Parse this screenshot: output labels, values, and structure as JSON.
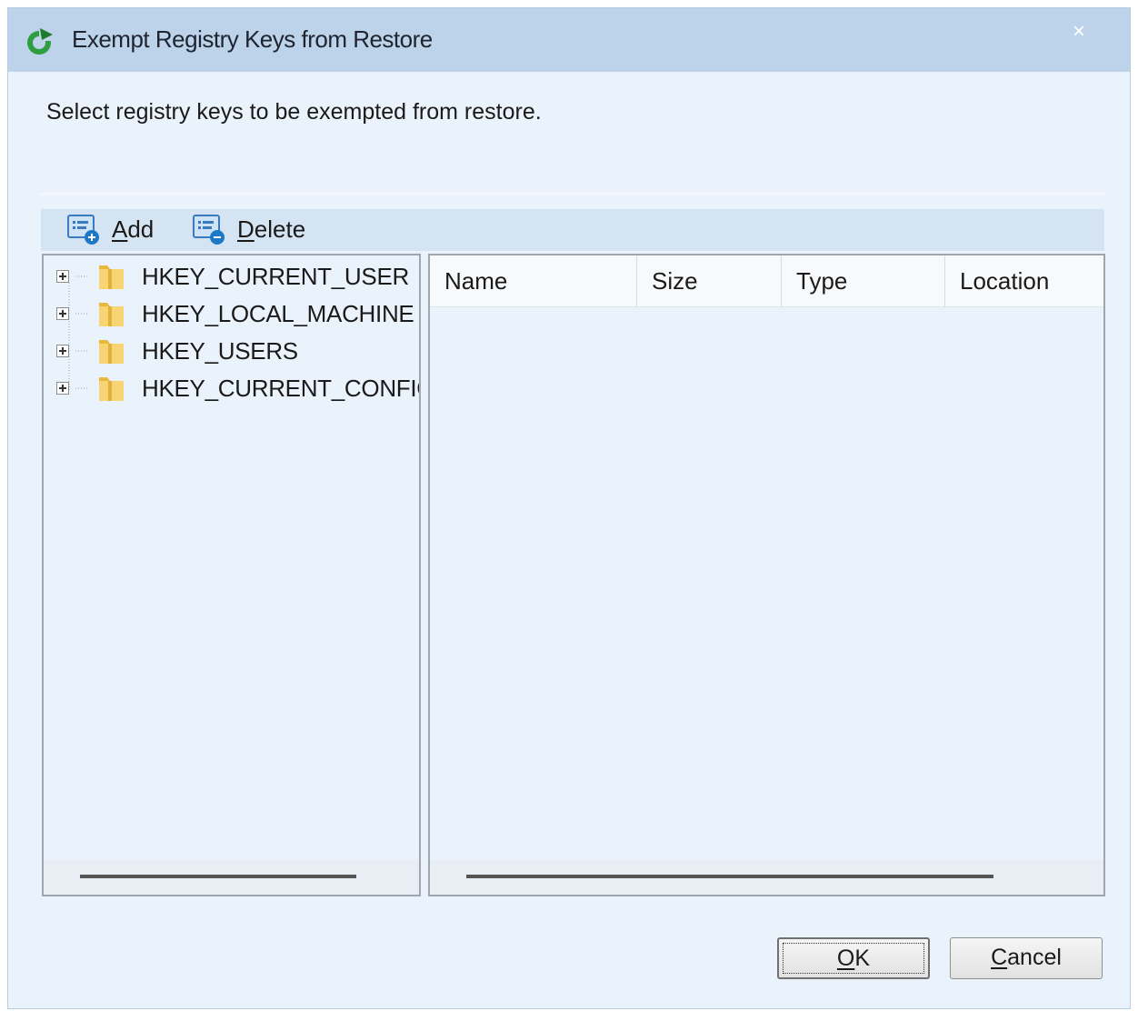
{
  "window": {
    "title": "Exempt Registry Keys from Restore",
    "close_glyph": "×"
  },
  "instruction": "Select registry keys to be exempted from restore.",
  "toolbar": {
    "add_accel": "A",
    "add_rest": "dd",
    "add_icon": "list-add-icon",
    "delete_accel": "D",
    "delete_rest": "elete",
    "delete_icon": "list-remove-icon"
  },
  "tree": {
    "items": [
      {
        "label": "HKEY_CURRENT_USER",
        "icon": "folder-icon",
        "expanded": false
      },
      {
        "label": "HKEY_LOCAL_MACHINE",
        "icon": "folder-icon",
        "expanded": false
      },
      {
        "label": "HKEY_USERS",
        "icon": "folder-icon",
        "expanded": false
      },
      {
        "label": "HKEY_CURRENT_CONFIG",
        "icon": "folder-icon",
        "expanded": false
      }
    ]
  },
  "list": {
    "columns": [
      "Name",
      "Size",
      "Type",
      "Location"
    ],
    "rows": []
  },
  "buttons": {
    "ok_accel": "O",
    "ok_rest": "K",
    "cancel_accel": "C",
    "cancel_rest": "ancel"
  },
  "colors": {
    "titlebar": "#bcd3ea",
    "dialog_bg": "#eaf3fb",
    "toolbar_bg": "#d5e4f2",
    "app_icon_green": "#2e9e3e"
  }
}
